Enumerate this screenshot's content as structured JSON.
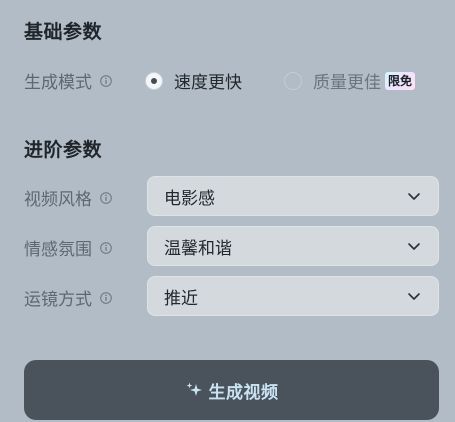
{
  "basic": {
    "title": "基础参数",
    "mode": {
      "label": "生成模式",
      "icon": "info-icon",
      "options": [
        {
          "label": "速度更快",
          "selected": true
        },
        {
          "label": "质量更佳",
          "selected": false,
          "badge": "限免"
        }
      ]
    }
  },
  "advanced": {
    "title": "进阶参数",
    "video_style": {
      "label": "视频风格",
      "value": "电影感",
      "icon": "info-icon"
    },
    "mood": {
      "label": "情感氛围",
      "value": "温馨和谐",
      "icon": "info-icon"
    },
    "camera": {
      "label": "运镜方式",
      "value": "推近",
      "icon": "info-icon"
    }
  },
  "generate_button": {
    "label": "生成视频",
    "icon": "sparkle-icon"
  },
  "colors": {
    "background": "#b2bcc6",
    "select_bg": "#d4d9de",
    "button_bg": "#4a525b",
    "button_text": "#c9e3f2"
  }
}
